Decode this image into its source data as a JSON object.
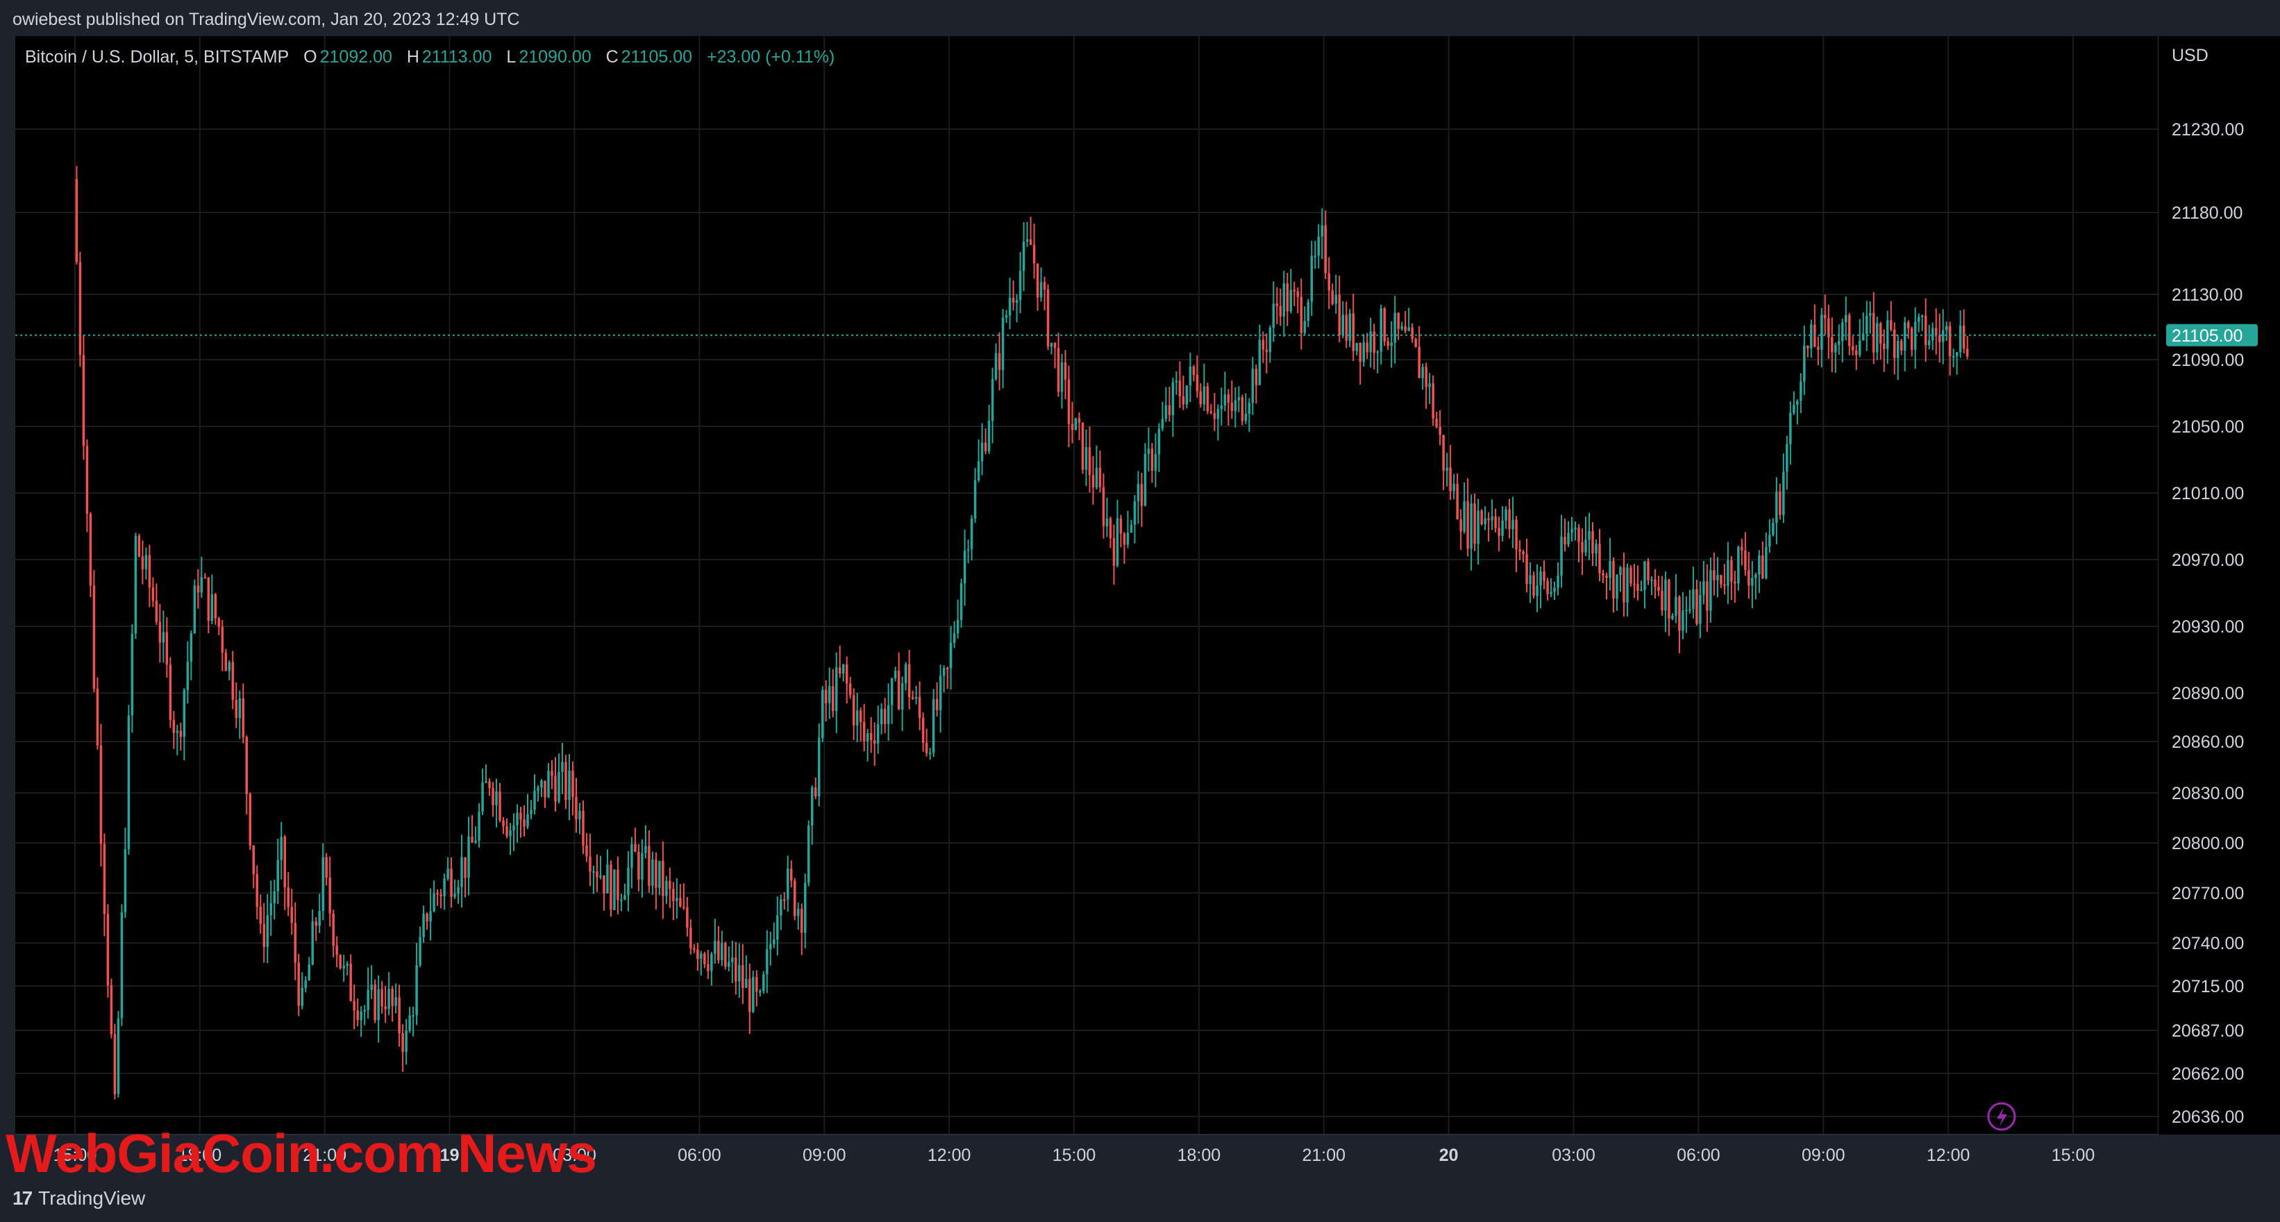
{
  "header": {
    "text": "owiebest published on TradingView.com, Jan 20, 2023 12:49 UTC"
  },
  "legend": {
    "symbol": "Bitcoin / U.S. Dollar, 5, BITSTAMP",
    "open_key": "O",
    "open": "21092.00",
    "high_key": "H",
    "high": "21113.00",
    "low_key": "L",
    "low": "21090.00",
    "close_key": "C",
    "close": "21105.00",
    "change": "+23.00 (+0.11%)"
  },
  "footer": {
    "brand": "TradingView",
    "brand_mark": "17"
  },
  "watermark": {
    "text": "WebGiaCoin.com News"
  },
  "colors": {
    "up": "#26a69a",
    "down": "#ef5350",
    "background": "#000000",
    "frame": "#1e222d",
    "grid": "#1c1c1c",
    "watermark": "#e51b1b",
    "price_tag": "#26a69a",
    "lightning": "#9c27b0"
  },
  "icons": {
    "lightning": "lightning-icon"
  },
  "chart_data": {
    "type": "line",
    "currency": "USD",
    "interval_minutes": 5,
    "x_tick_labels": [
      "15:00",
      "18:00",
      "21:00",
      "19",
      "03:00",
      "06:00",
      "09:00",
      "12:00",
      "15:00",
      "18:00",
      "21:00",
      "20",
      "03:00",
      "06:00",
      "09:00",
      "12:00",
      "15:00"
    ],
    "y_tick_labels": [
      "21230.00",
      "21180.00",
      "21130.00",
      "21090.00",
      "21050.00",
      "21010.00",
      "20970.00",
      "20930.00",
      "20890.00",
      "20860.00",
      "20830.00",
      "20800.00",
      "20770.00",
      "20740.00",
      "20715.00",
      "20687.00",
      "20662.00",
      "20636.00"
    ],
    "y_ticks": [
      21230,
      21180,
      21130,
      21090,
      21050,
      21010,
      20970,
      20930,
      20890,
      20860,
      20830,
      20800,
      20770,
      20740,
      20715,
      20687,
      20662,
      20636
    ],
    "last_price": 21105.0,
    "last_price_label": "21105.00",
    "x_range": [
      "2023-01-18T13:30",
      "2023-01-20T16:30"
    ],
    "series": [
      {
        "x": [
          "2023-01-18T15:00",
          "2023-01-18T15:30",
          "2023-01-18T16:00",
          "2023-01-18T16:30",
          "2023-01-18T17:00",
          "2023-01-18T17:30",
          "2023-01-18T18:00",
          "2023-01-18T18:30",
          "2023-01-18T19:00",
          "2023-01-18T19:30",
          "2023-01-18T20:00",
          "2023-01-18T20:30",
          "2023-01-18T21:00",
          "2023-01-18T21:30",
          "2023-01-18T22:00",
          "2023-01-18T22:30",
          "2023-01-18T23:00",
          "2023-01-18T23:30",
          "2023-01-19T00:00",
          "2023-01-19T00:30",
          "2023-01-19T01:00",
          "2023-01-19T01:30",
          "2023-01-19T02:00",
          "2023-01-19T02:30",
          "2023-01-19T03:00",
          "2023-01-19T03:30",
          "2023-01-19T04:00",
          "2023-01-19T04:30",
          "2023-01-19T05:00",
          "2023-01-19T05:30",
          "2023-01-19T06:00",
          "2023-01-19T06:30",
          "2023-01-19T07:00",
          "2023-01-19T07:30",
          "2023-01-19T08:00",
          "2023-01-19T08:30",
          "2023-01-19T09:00",
          "2023-01-19T09:30",
          "2023-01-19T10:00",
          "2023-01-19T10:30",
          "2023-01-19T11:00",
          "2023-01-19T11:30",
          "2023-01-19T12:00",
          "2023-01-19T12:30",
          "2023-01-19T13:00",
          "2023-01-19T13:30",
          "2023-01-19T14:00",
          "2023-01-19T14:30",
          "2023-01-19T15:00",
          "2023-01-19T15:30",
          "2023-01-19T16:00",
          "2023-01-19T16:30",
          "2023-01-19T17:00",
          "2023-01-19T17:30",
          "2023-01-19T18:00",
          "2023-01-19T18:30",
          "2023-01-19T19:00",
          "2023-01-19T19:30",
          "2023-01-19T20:00",
          "2023-01-19T20:30",
          "2023-01-19T21:00",
          "2023-01-19T21:30",
          "2023-01-19T22:00",
          "2023-01-19T22:30",
          "2023-01-19T23:00",
          "2023-01-19T23:30",
          "2023-01-20T00:00",
          "2023-01-20T00:30",
          "2023-01-20T01:00",
          "2023-01-20T01:30",
          "2023-01-20T02:00",
          "2023-01-20T02:30",
          "2023-01-20T03:00",
          "2023-01-20T03:30",
          "2023-01-20T04:00",
          "2023-01-20T04:30",
          "2023-01-20T05:00",
          "2023-01-20T05:30",
          "2023-01-20T06:00",
          "2023-01-20T06:30",
          "2023-01-20T07:00",
          "2023-01-20T07:30",
          "2023-01-20T08:00",
          "2023-01-20T08:30",
          "2023-01-20T09:00",
          "2023-01-20T09:30",
          "2023-01-20T10:00",
          "2023-01-20T10:30",
          "2023-01-20T11:00",
          "2023-01-20T11:30",
          "2023-01-20T12:00",
          "2023-01-20T12:30"
        ],
        "values": [
          21200,
          20900,
          20636,
          20980,
          20940,
          20860,
          20960,
          20930,
          20880,
          20740,
          20790,
          20700,
          20780,
          20720,
          20700,
          20710,
          20680,
          20760,
          20780,
          20790,
          20840,
          20810,
          20820,
          20840,
          20830,
          20790,
          20770,
          20790,
          20780,
          20760,
          20740,
          20730,
          20720,
          20700,
          20780,
          20760,
          20880,
          20900,
          20860,
          20880,
          20900,
          20860,
          20900,
          20990,
          21060,
          21130,
          21160,
          21100,
          21050,
          21020,
          20980,
          21000,
          21040,
          21070,
          21080,
          21060,
          21060,
          21090,
          21130,
          21120,
          21160,
          21110,
          21100,
          21110,
          21100,
          21080,
          21020,
          20990,
          21000,
          20990,
          20960,
          20950,
          20990,
          20980,
          20960,
          20950,
          20960,
          20940,
          20940,
          20960,
          20970,
          20960,
          21010,
          21090,
          21105,
          21105,
          21105,
          21105,
          21105,
          21105,
          21105,
          21105
        ]
      }
    ]
  }
}
